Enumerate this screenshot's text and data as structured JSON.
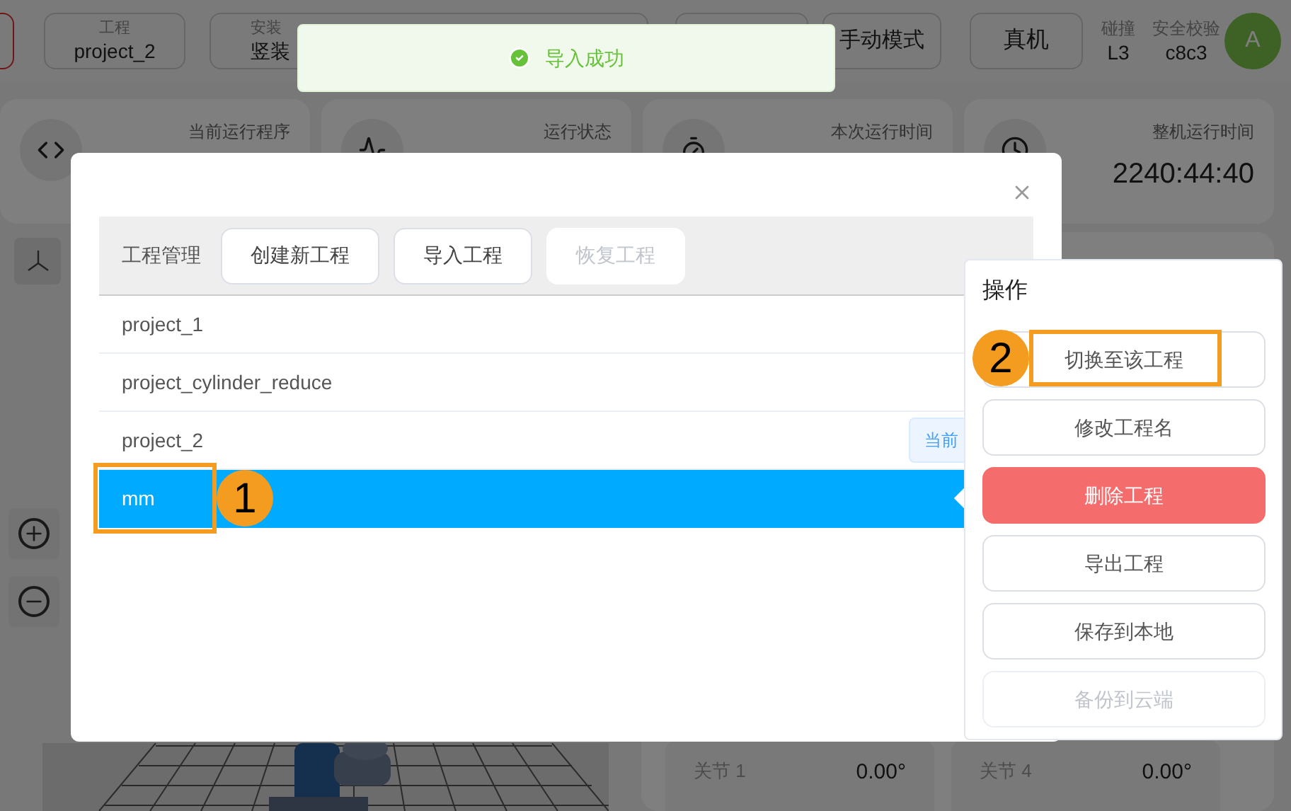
{
  "top_bar": {
    "fields": [
      {
        "label": "工程",
        "value": "project_2"
      },
      {
        "label": "安装",
        "value": "竖装"
      }
    ],
    "mode_button": "手动模式",
    "target_button": "真机",
    "collision": {
      "label": "碰撞",
      "value": "L3"
    },
    "safety": {
      "label": "安全校验",
      "value": "c8c3"
    },
    "avatar": "A"
  },
  "status_cards": [
    {
      "kind": "program",
      "label": "当前运行程序"
    },
    {
      "kind": "status",
      "label": "运行状态"
    },
    {
      "kind": "timer",
      "label": "本次运行时间"
    },
    {
      "kind": "clock",
      "label": "整机运行时间",
      "value": "2240:44:40"
    }
  ],
  "joints": [
    {
      "label": "关节 1",
      "value": "0.00°"
    },
    {
      "label": "关节 4",
      "value": "0.00°"
    }
  ],
  "toast": {
    "message": "导入成功"
  },
  "dialog": {
    "toolbar_title": "工程管理",
    "buttons": [
      {
        "label": "创建新工程",
        "disabled": false
      },
      {
        "label": "导入工程",
        "disabled": false
      },
      {
        "label": "恢复工程",
        "disabled": true
      }
    ],
    "projects": [
      {
        "name": "project_1",
        "selected": false
      },
      {
        "name": "project_cylinder_reduce",
        "selected": false
      },
      {
        "name": "project_2",
        "selected": false,
        "tag": "当前"
      },
      {
        "name": "mm",
        "selected": true
      }
    ]
  },
  "actions_menu": {
    "title": "操作",
    "items": [
      {
        "label": "切换至该工程",
        "kind": "normal",
        "disabled": false
      },
      {
        "label": "修改工程名",
        "kind": "normal",
        "disabled": false
      },
      {
        "label": "删除工程",
        "kind": "danger",
        "disabled": false
      },
      {
        "label": "导出工程",
        "kind": "normal",
        "disabled": false
      },
      {
        "label": "保存到本地",
        "kind": "normal",
        "disabled": false
      },
      {
        "label": "备份到云端",
        "kind": "normal",
        "disabled": true
      }
    ]
  },
  "annotations": [
    {
      "number": "1"
    },
    {
      "number": "2"
    }
  ]
}
